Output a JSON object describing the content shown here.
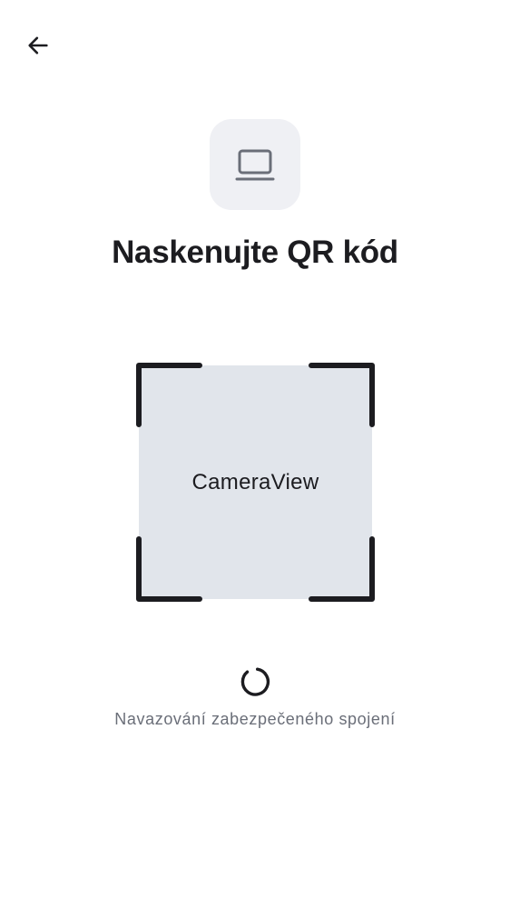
{
  "header": {
    "back_icon": "arrow-left-icon"
  },
  "device": {
    "icon": "laptop-icon"
  },
  "title": "Naskenujte QR kód",
  "scanner": {
    "camera_label": "CameraView"
  },
  "status": {
    "text": "Navazování zabezpečeného spojení",
    "spinner_icon": "loading-spinner-icon"
  },
  "colors": {
    "frame": "#1c1c20",
    "camera_bg": "#e1e5eb",
    "tile_bg": "#eff0f4",
    "muted_text": "#6a6e78"
  }
}
